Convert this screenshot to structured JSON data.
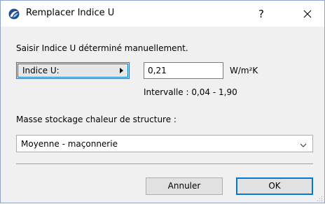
{
  "window": {
    "title": "Remplacer Indice U",
    "help_label": "?",
    "icons": {
      "app": "archicad-logo-icon",
      "close": "close-icon"
    },
    "accent_color": "#0078d7"
  },
  "main": {
    "instruction": "Saisir Indice U déterminé manuellement.",
    "indice_button_label": "Indice U:",
    "value": "0,21",
    "unit": "W/m²K",
    "range": "Intervalle : 0,04 - 1,90",
    "mass_label": "Masse stockage chaleur de structure :",
    "mass_selected": "Moyenne - maçonnerie"
  },
  "buttons": {
    "cancel": "Annuler",
    "ok": "OK"
  }
}
